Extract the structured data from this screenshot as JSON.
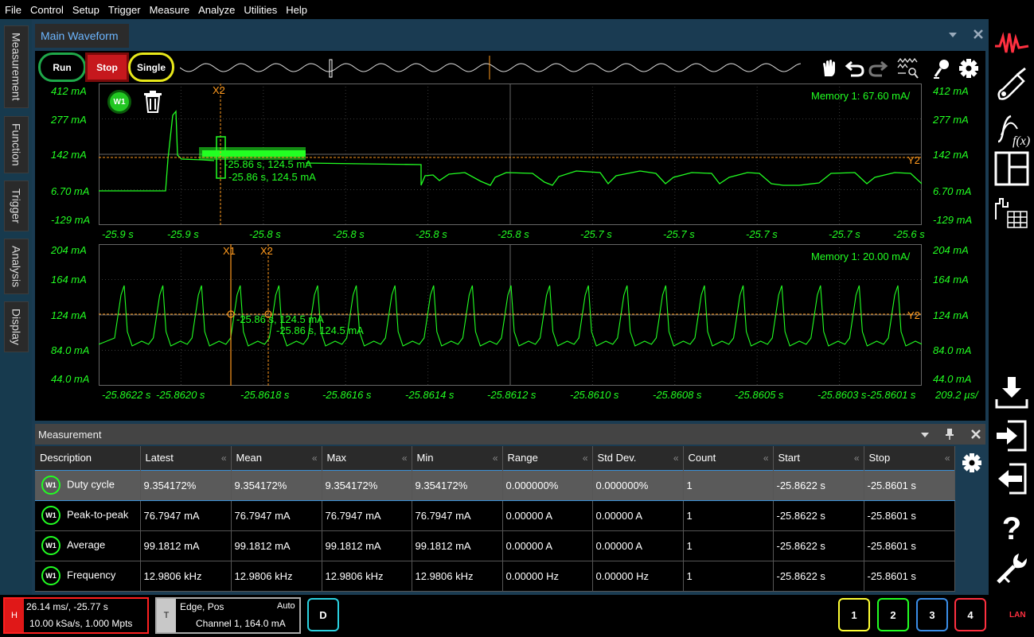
{
  "menu": [
    "File",
    "Control",
    "Setup",
    "Trigger",
    "Measure",
    "Analyze",
    "Utilities",
    "Help"
  ],
  "side_tabs": [
    "Measurement",
    "Function",
    "Trigger",
    "Analysis",
    "Display"
  ],
  "window": {
    "title": "Main Waveform"
  },
  "controls": {
    "run": "Run",
    "stop": "Stop",
    "single": "Single"
  },
  "top_plot": {
    "y_labels": [
      "412 mA",
      "277 mA",
      "142 mA",
      "6.70 mA",
      "-129 mA"
    ],
    "x_labels": [
      "-25.9 s",
      "-25.9 s",
      "-25.8 s",
      "-25.8 s",
      "-25.8 s",
      "-25.8 s",
      "-25.7 s",
      "-25.7 s",
      "-25.7 s",
      "-25.7 s",
      "-25.6 s"
    ],
    "memory_label": "Memory 1:  67.60 mA/",
    "cursor_x2": "X2",
    "cursor_y2": "Y2",
    "readout_1": "-25.86 s, 124.5 mA",
    "readout_2": "-25.86 s, 124.5 mA",
    "badge": "W1"
  },
  "bottom_plot": {
    "y_labels": [
      "204 mA",
      "164 mA",
      "124 mA",
      "84.0 mA",
      "44.0 mA"
    ],
    "x_labels": [
      "-25.8622 s",
      "-25.8620 s",
      "-25.8618 s",
      "-25.8616 s",
      "-25.8614 s",
      "-25.8612 s",
      "-25.8610 s",
      "-25.8608 s",
      "-25.8605 s",
      "-25.8603 s",
      "-25.8601 s"
    ],
    "memory_label": "Memory 1:  20.00 mA/",
    "cursor_x1": "X1",
    "cursor_x2": "X2",
    "cursor_y2": "Y2",
    "readout_1": "-25.86 s, 124.5 mA",
    "readout_2": "-25.86 s, 124.5 mA",
    "timebase": "209.2 µs/"
  },
  "measurement": {
    "title": "Measurement",
    "columns": [
      "Description",
      "Latest",
      "Mean",
      "Max",
      "Min",
      "Range",
      "Std Dev.",
      "Count",
      "Start",
      "Stop"
    ],
    "rows": [
      {
        "badge": "W1",
        "cells": [
          "Duty cycle",
          "9.354172%",
          "9.354172%",
          "9.354172%",
          "9.354172%",
          "0.000000%",
          "0.000000%",
          "1",
          "-25.8622 s",
          "-25.8601 s"
        ]
      },
      {
        "badge": "W1",
        "cells": [
          "Peak-to-peak",
          "76.7947 mA",
          "76.7947 mA",
          "76.7947 mA",
          "76.7947 mA",
          "0.00000 A",
          "0.00000 A",
          "1",
          "-25.8622 s",
          "-25.8601 s"
        ]
      },
      {
        "badge": "W1",
        "cells": [
          "Average",
          "99.1812 mA",
          "99.1812 mA",
          "99.1812 mA",
          "99.1812 mA",
          "0.00000 A",
          "0.00000 A",
          "1",
          "-25.8622 s",
          "-25.8601 s"
        ]
      },
      {
        "badge": "W1",
        "cells": [
          "Frequency",
          "12.9806 kHz",
          "12.9806 kHz",
          "12.9806 kHz",
          "12.9806 kHz",
          "0.00000 Hz",
          "0.00000 Hz",
          "1",
          "-25.8622 s",
          "-25.8601 s"
        ]
      }
    ]
  },
  "status": {
    "h_letter": "H",
    "h_line1": "26.14 ms/, -25.77 s",
    "h_line2": "10.00 kSa/s, 1.000 Mpts",
    "t_letter": "T",
    "t_line1": "Edge, Pos",
    "t_mode": "Auto",
    "t_line2": "Channel 1, 164.0 mA",
    "d_label": "D",
    "channels": [
      "1",
      "2",
      "3",
      "4"
    ],
    "lan": "LAN"
  },
  "colors": {
    "trace": "#22ff22",
    "cursor": "#ff9a1e",
    "ch1": "#ffff33",
    "ch2": "#22ff22",
    "ch3": "#3a8ee8",
    "ch4": "#ff3040",
    "accent": "#ff3040"
  },
  "icons": [
    "pan-hand-icon",
    "undo-icon",
    "redo-icon",
    "waveform-zoom-icon",
    "probe-icon",
    "gear-icon",
    "keysight-wave-logo-icon",
    "probe-connect-icon",
    "function-fx-icon",
    "layout-icon",
    "table-chart-icon",
    "save-icon",
    "import-icon",
    "export-icon",
    "help-icon",
    "wrench-icon",
    "trash-icon"
  ]
}
